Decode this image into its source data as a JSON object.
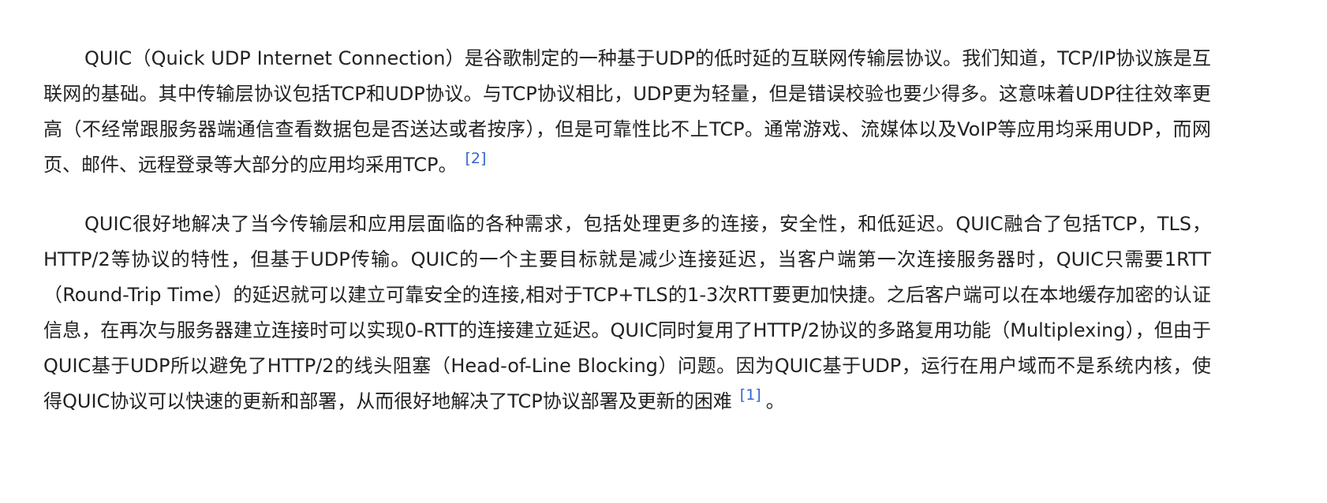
{
  "paragraphs": [
    {
      "text": "QUIC（Quick UDP Internet Connection）是谷歌制定的一种基于UDP的低时延的互联网传输层协议。我们知道，TCP/IP协议族是互联网的基础。其中传输层协议包括TCP和UDP协议。与TCP协议相比，UDP更为轻量，但是错误校验也要少得多。这意味着UDP往往效率更高（不经常跟服务器端通信查看数据包是否送达或者按序），但是可靠性比不上TCP。通常游戏、流媒体以及VoIP等应用均采用UDP，而网页、邮件、远程登录等大部分的应用均采用TCP。",
      "ref": "[2]",
      "tail": ""
    },
    {
      "text": "QUIC很好地解决了当今传输层和应用层面临的各种需求，包括处理更多的连接，安全性，和低延迟。QUIC融合了包括TCP，TLS，HTTP/2等协议的特性，但基于UDP传输。QUIC的一个主要目标就是减少连接延迟，当客户端第一次连接服务器时，QUIC只需要1RTT（Round-Trip Time）的延迟就可以建立可靠安全的连接,相对于TCP+TLS的1-3次RTT要更加快捷。之后客户端可以在本地缓存加密的认证信息，在再次与服务器建立连接时可以实现0-RTT的连接建立延迟。QUIC同时复用了HTTP/2协议的多路复用功能（Multiplexing），但由于QUIC基于UDP所以避免了HTTP/2的线头阻塞（Head-of-Line Blocking）问题。因为QUIC基于UDP，运行在用户域而不是系统内核，使得QUIC协议可以快速的更新和部署，从而很好地解决了TCP协议部署及更新的困难",
      "ref": "[1]",
      "tail": "。"
    }
  ]
}
